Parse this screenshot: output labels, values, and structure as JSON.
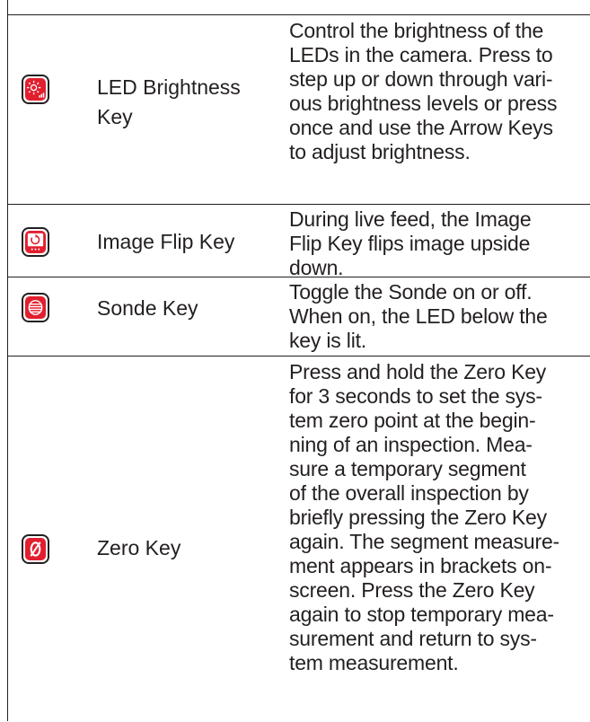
{
  "rows": [
    {
      "icon": "led-brightness-icon",
      "name": "LED Brightness\nKey",
      "description": "Control the brightness of the\nLEDs in the camera. Press to\nstep up or down through vari-\nous brightness levels or press\nonce and use the Arrow Keys\nto adjust brightness."
    },
    {
      "icon": "image-flip-icon",
      "name": "Image Flip Key",
      "description": "During live feed, the Image\nFlip Key flips image upside\ndown."
    },
    {
      "icon": "sonde-icon",
      "name": "Sonde Key",
      "description": "Toggle the Sonde on or off.\nWhen on, the LED below the\nkey is lit."
    },
    {
      "icon": "zero-key-icon",
      "name": "Zero Key",
      "description": "Press and hold the Zero Key\nfor 3 seconds to set the sys-\ntem zero point at the begin-\nning of an inspection. Mea-\nsure a temporary segment\nof the overall inspection by\nbriefly pressing the Zero Key\nagain. The segment measure-\nment appears in brackets on-\nscreen. Press the Zero Key\nagain to stop temporary mea-\nsurement and return to sys-\ntem measurement."
    }
  ],
  "colors": {
    "accent": "#e21f2f",
    "text": "#231f20",
    "rule": "#231f20"
  }
}
